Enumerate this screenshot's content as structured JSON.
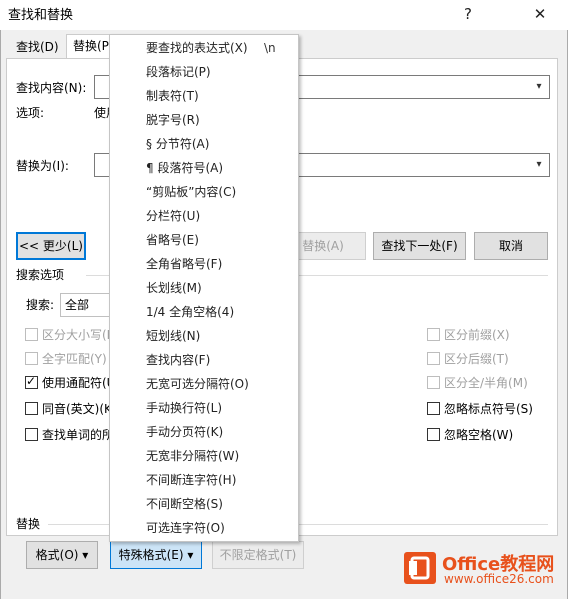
{
  "window": {
    "title": "查找和替换",
    "help_label": "?",
    "close_label": "✕"
  },
  "tabs": [
    {
      "label": "查找(D)"
    },
    {
      "label": "替换(P"
    }
  ],
  "find": {
    "label": "查找内容(N):",
    "value": "",
    "options_label": "选项:",
    "options_value": "使用"
  },
  "replace": {
    "label": "替换为(I):",
    "value": ""
  },
  "buttons": {
    "less": "<< 更少(L)",
    "replace": "替换(A)",
    "find_next": "查找下一处(F)",
    "cancel": "取消"
  },
  "search_options": {
    "section_label": "搜索选项",
    "search_label": "搜索:",
    "search_value": "全部",
    "left_checks": [
      {
        "label": "区分大小写(H",
        "checked": false,
        "disabled": true
      },
      {
        "label": "全字匹配(Y)",
        "checked": false,
        "disabled": true
      },
      {
        "label": "使用通配符(U",
        "checked": true,
        "disabled": false
      },
      {
        "label": "同音(英文)(K",
        "checked": false,
        "disabled": false
      },
      {
        "label": "查找单词的所",
        "checked": false,
        "disabled": false
      }
    ],
    "right_checks": [
      {
        "label": "区分前缀(X)",
        "checked": false,
        "disabled": true
      },
      {
        "label": "区分后缀(T)",
        "checked": false,
        "disabled": true
      },
      {
        "label": "区分全/半角(M)",
        "checked": false,
        "disabled": true
      },
      {
        "label": "忽略标点符号(S)",
        "checked": false,
        "disabled": false
      },
      {
        "label": "忽略空格(W)",
        "checked": false,
        "disabled": false
      }
    ]
  },
  "replace_section": {
    "label": "替换",
    "format_btn": "格式(O) ▾",
    "special_btn": "特殊格式(E) ▾",
    "no_format_btn": "不限定格式(T)"
  },
  "special_menu": [
    {
      "label": "要查找的表达式(X)",
      "shortcut": "\\n"
    },
    {
      "label": "段落标记(P)"
    },
    {
      "label": "制表符(T)"
    },
    {
      "label": "脱字号(R)"
    },
    {
      "label": "§ 分节符(A)"
    },
    {
      "label": "¶ 段落符号(A)"
    },
    {
      "label": "“剪贴板”内容(C)"
    },
    {
      "label": "分栏符(U)"
    },
    {
      "label": "省略号(E)"
    },
    {
      "label": "全角省略号(F)"
    },
    {
      "label": "长划线(M)"
    },
    {
      "label": "1/4 全角空格(4)"
    },
    {
      "label": "短划线(N)"
    },
    {
      "label": "查找内容(F)"
    },
    {
      "label": "无宽可选分隔符(O)"
    },
    {
      "label": "手动换行符(L)"
    },
    {
      "label": "手动分页符(K)"
    },
    {
      "label": "无宽非分隔符(W)"
    },
    {
      "label": "不间断连字符(H)"
    },
    {
      "label": "不间断空格(S)"
    },
    {
      "label": "可选连字符(O)"
    }
  ],
  "watermark": {
    "brand": "Office教程网",
    "url": "www.office26.com",
    "accent": "#e8511c"
  }
}
